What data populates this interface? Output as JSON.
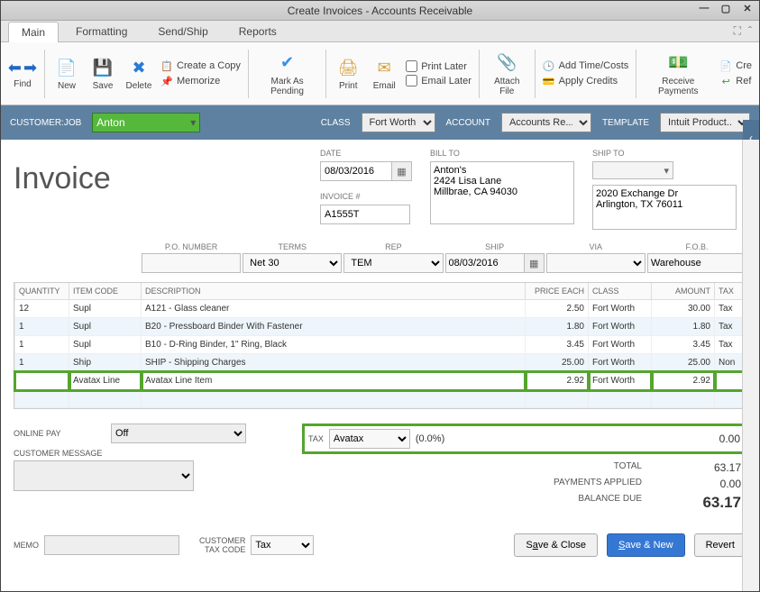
{
  "window": {
    "title": "Create Invoices - Accounts Receivable"
  },
  "tabs": {
    "main": "Main",
    "formatting": "Formatting",
    "sendship": "Send/Ship",
    "reports": "Reports"
  },
  "ribbon": {
    "find": "Find",
    "new": "New",
    "save": "Save",
    "delete": "Delete",
    "create_copy": "Create a Copy",
    "memorize": "Memorize",
    "mark_pending": "Mark As Pending",
    "print": "Print",
    "email": "Email",
    "print_later": "Print Later",
    "email_later": "Email Later",
    "attach_file": "Attach File",
    "add_time_costs": "Add Time/Costs",
    "apply_credits": "Apply Credits",
    "receive_payments": "Receive Payments",
    "cre": "Cre",
    "ref": "Ref"
  },
  "contextbar": {
    "customer_label": "CUSTOMER:JOB",
    "customer_value": "Anton",
    "class_label": "CLASS",
    "class_value": "Fort Worth",
    "account_label": "ACCOUNT",
    "account_value": "Accounts Re...",
    "template_label": "TEMPLATE",
    "template_value": "Intuit Product..."
  },
  "invoice": {
    "title": "Invoice",
    "date_label": "DATE",
    "date_value": "08/03/2016",
    "number_label": "INVOICE #",
    "number_value": "A1555T",
    "billto_label": "BILL TO",
    "billto_value": "Anton's\n2424 Lisa Lane\nMillbrae, CA 94030",
    "shipto_label": "SHIP TO",
    "shipto_value": "2020 Exchange Dr\nArlington, TX 76011"
  },
  "meta": {
    "po_label": "P.O. NUMBER",
    "po_value": "",
    "terms_label": "TERMS",
    "terms_value": "Net 30",
    "rep_label": "REP",
    "rep_value": "TEM",
    "ship_label": "SHIP",
    "ship_value": "08/03/2016",
    "via_label": "VIA",
    "via_value": "",
    "fob_label": "F.O.B.",
    "fob_value": "Warehouse"
  },
  "columns": {
    "qty": "QUANTITY",
    "item": "ITEM CODE",
    "desc": "DESCRIPTION",
    "price": "PRICE EACH",
    "class": "CLASS",
    "amount": "AMOUNT",
    "tax": "TAX"
  },
  "lines": [
    {
      "qty": "12",
      "item": "Supl",
      "desc": "A121 - Glass cleaner",
      "price": "2.50",
      "class": "Fort Worth",
      "amount": "30.00",
      "tax": "Tax"
    },
    {
      "qty": "1",
      "item": "Supl",
      "desc": "B20 - Pressboard Binder With Fastener",
      "price": "1.80",
      "class": "Fort Worth",
      "amount": "1.80",
      "tax": "Tax"
    },
    {
      "qty": "1",
      "item": "Supl",
      "desc": "B10 - D-Ring Binder, 1\" Ring, Black",
      "price": "3.45",
      "class": "Fort Worth",
      "amount": "3.45",
      "tax": "Tax"
    },
    {
      "qty": "1",
      "item": "Ship",
      "desc": "SHIP - Shipping Charges",
      "price": "25.00",
      "class": "Fort Worth",
      "amount": "25.00",
      "tax": "Non"
    },
    {
      "qty": "",
      "item": "Avatax Line",
      "desc": "Avatax Line Item",
      "price": "2.92",
      "class": "Fort Worth",
      "amount": "2.92",
      "tax": ""
    }
  ],
  "leftfooter": {
    "onlinepay_label": "ONLINE PAY",
    "onlinepay_value": "Off",
    "custmsg_label": "CUSTOMER MESSAGE",
    "memo_label": "MEMO",
    "custtaxcode_label": "CUSTOMER TAX CODE",
    "custtaxcode_value": "Tax"
  },
  "totals": {
    "tax_label": "TAX",
    "tax_item": "Avatax",
    "tax_pct": "(0.0%)",
    "tax_amount": "0.00",
    "total_label": "TOTAL",
    "total_value": "63.17",
    "payments_label": "PAYMENTS APPLIED",
    "payments_value": "0.00",
    "balance_label": "BALANCE DUE",
    "balance_value": "63.17"
  },
  "buttons": {
    "save_close_a": "S",
    "save_close_u": "a",
    "save_close_b": "ve & Close",
    "save_new_a": "",
    "save_new_u": "S",
    "save_new_b": "ave & New",
    "revert": "Revert"
  }
}
